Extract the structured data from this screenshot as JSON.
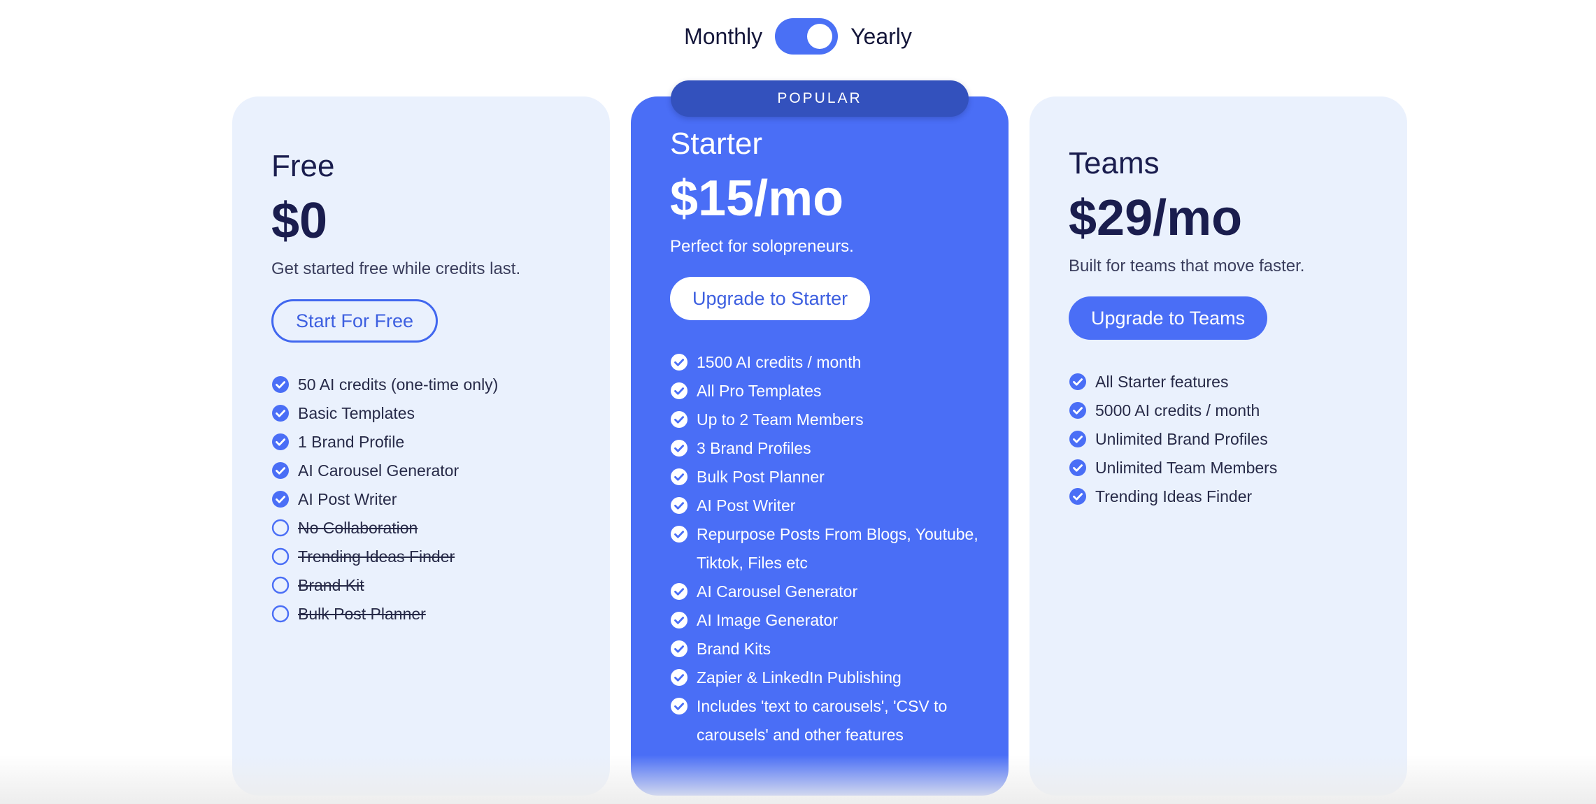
{
  "billing_toggle": {
    "monthly_label": "Monthly",
    "yearly_label": "Yearly",
    "selected": "Yearly"
  },
  "popular_badge": "POPULAR",
  "colors": {
    "accent": "#4a6ef6",
    "badge": "#3351bd",
    "card_light": "#eaf1fd",
    "heading": "#1a1d4e"
  },
  "plans": [
    {
      "name": "Free",
      "price": "$0",
      "description": "Get started free while credits last.",
      "cta": "Start For Free",
      "features": [
        {
          "text": "50 AI credits (one-time only)",
          "included": true
        },
        {
          "text": "Basic Templates",
          "included": true
        },
        {
          "text": "1 Brand Profile",
          "included": true
        },
        {
          "text": "AI Carousel Generator",
          "included": true
        },
        {
          "text": "AI Post Writer",
          "included": true
        },
        {
          "text": "No Collaboration",
          "included": false
        },
        {
          "text": "Trending Ideas Finder",
          "included": false
        },
        {
          "text": "Brand Kit",
          "included": false
        },
        {
          "text": "Bulk Post Planner",
          "included": false
        }
      ]
    },
    {
      "name": "Starter",
      "price": "$15/mo",
      "description": "Perfect for solopreneurs.",
      "cta": "Upgrade to Starter",
      "features": [
        {
          "text": "1500 AI credits / month",
          "included": true
        },
        {
          "text": "All Pro Templates",
          "included": true
        },
        {
          "text": "Up to 2 Team Members",
          "included": true
        },
        {
          "text": "3 Brand Profiles",
          "included": true
        },
        {
          "text": "Bulk Post Planner",
          "included": true
        },
        {
          "text": "AI Post Writer",
          "included": true
        },
        {
          "text": "Repurpose Posts From Blogs, Youtube, Tiktok, Files etc",
          "included": true
        },
        {
          "text": "AI Carousel Generator",
          "included": true
        },
        {
          "text": "AI Image Generator",
          "included": true
        },
        {
          "text": "Brand Kits",
          "included": true
        },
        {
          "text": "Zapier & LinkedIn Publishing",
          "included": true
        },
        {
          "text": "Includes 'text to carousels', 'CSV to carousels' and other features",
          "included": true
        }
      ]
    },
    {
      "name": "Teams",
      "price": "$29/mo",
      "description": "Built for teams that move faster.",
      "cta": "Upgrade to Teams",
      "features": [
        {
          "text": "All Starter features",
          "included": true
        },
        {
          "text": "5000 AI credits / month",
          "included": true
        },
        {
          "text": "Unlimited Brand Profiles",
          "included": true
        },
        {
          "text": "Unlimited Team Members",
          "included": true
        },
        {
          "text": "Trending Ideas Finder",
          "included": true
        }
      ]
    }
  ]
}
